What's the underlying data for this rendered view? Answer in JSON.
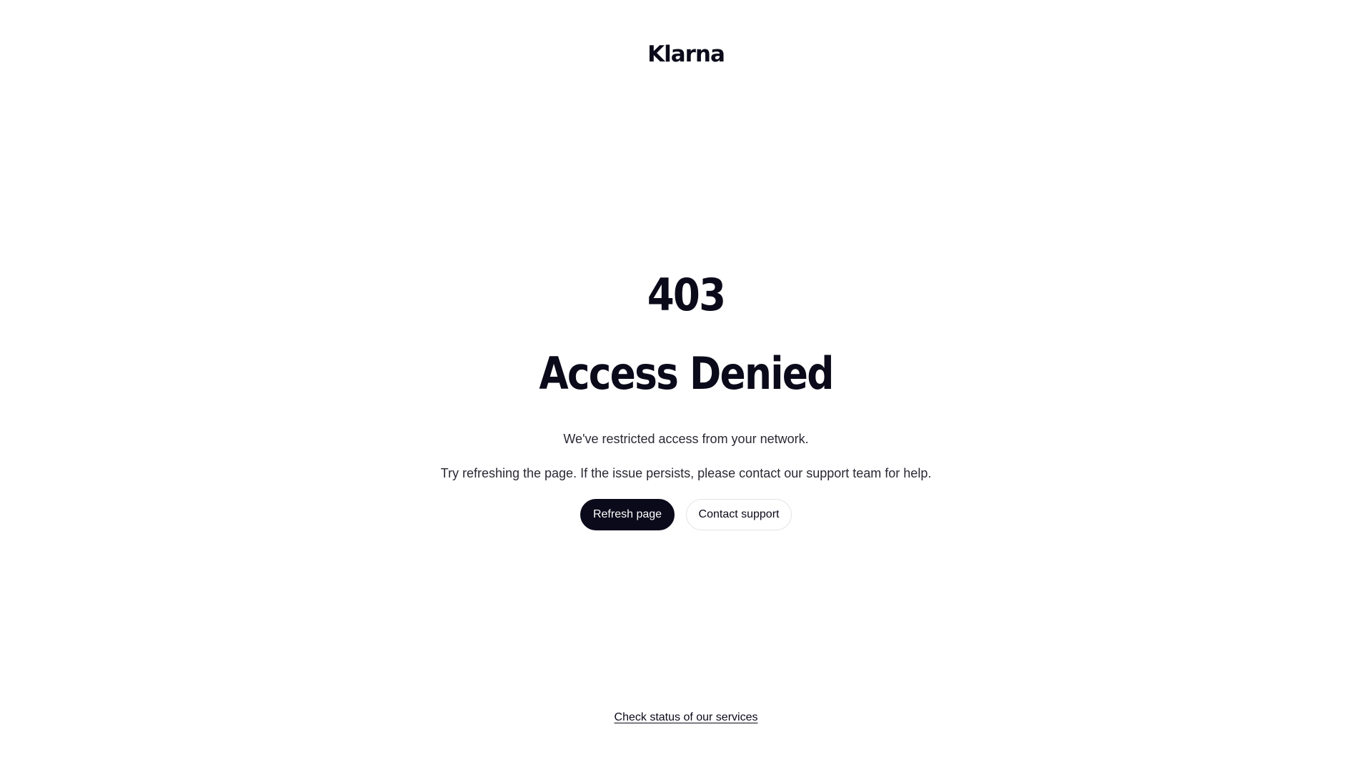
{
  "header": {
    "logo_text": "Klarna"
  },
  "error": {
    "code": "403",
    "title": "Access Denied",
    "message_primary": "We've restricted access from your network.",
    "message_secondary": "Try refreshing the page. If the issue persists, please contact our support team for help."
  },
  "actions": {
    "refresh_label": "Refresh page",
    "contact_label": "Contact support"
  },
  "footer": {
    "status_link_label": "Check status of our services"
  },
  "colors": {
    "text_primary": "#0b0a1a",
    "background": "#ffffff",
    "button_primary_bg": "#0b0a1a",
    "button_secondary_border": "#e3e3e6"
  }
}
